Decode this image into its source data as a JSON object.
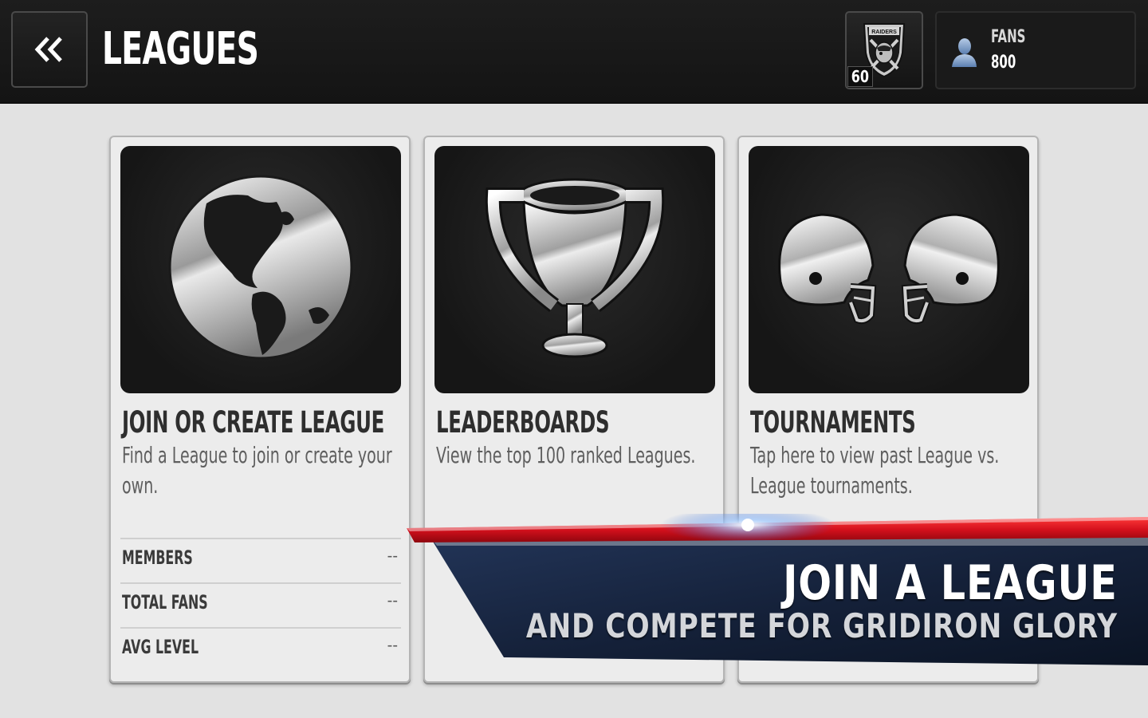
{
  "header": {
    "back_icon": "double-chevron-left-icon",
    "title": "LEAGUES",
    "team": {
      "logo_icon": "raiders-shield-icon",
      "level": "60"
    },
    "fans": {
      "icon": "person-silhouette-icon",
      "label": "FANS",
      "value": "800"
    }
  },
  "cards": [
    {
      "icon": "globe-icon",
      "title": "JOIN OR CREATE LEAGUE",
      "description": "Find a League to join or create your own.",
      "stats": [
        {
          "label": "MEMBERS",
          "value": "--"
        },
        {
          "label": "TOTAL FANS",
          "value": "--"
        },
        {
          "label": "AVG LEVEL",
          "value": "--"
        }
      ]
    },
    {
      "icon": "trophy-icon",
      "title": "LEADERBOARDS",
      "description": "View the top 100 ranked Leagues."
    },
    {
      "icon": "facing-helmets-icon",
      "title": "TOURNAMENTS",
      "description": "Tap here to view past League vs. League tournaments."
    }
  ],
  "promo": {
    "line1": "JOIN A LEAGUE",
    "line2": "AND COMPETE FOR GRIDIRON GLORY",
    "accent_color": "#d4101c",
    "panel_color": "#1b2a45"
  }
}
